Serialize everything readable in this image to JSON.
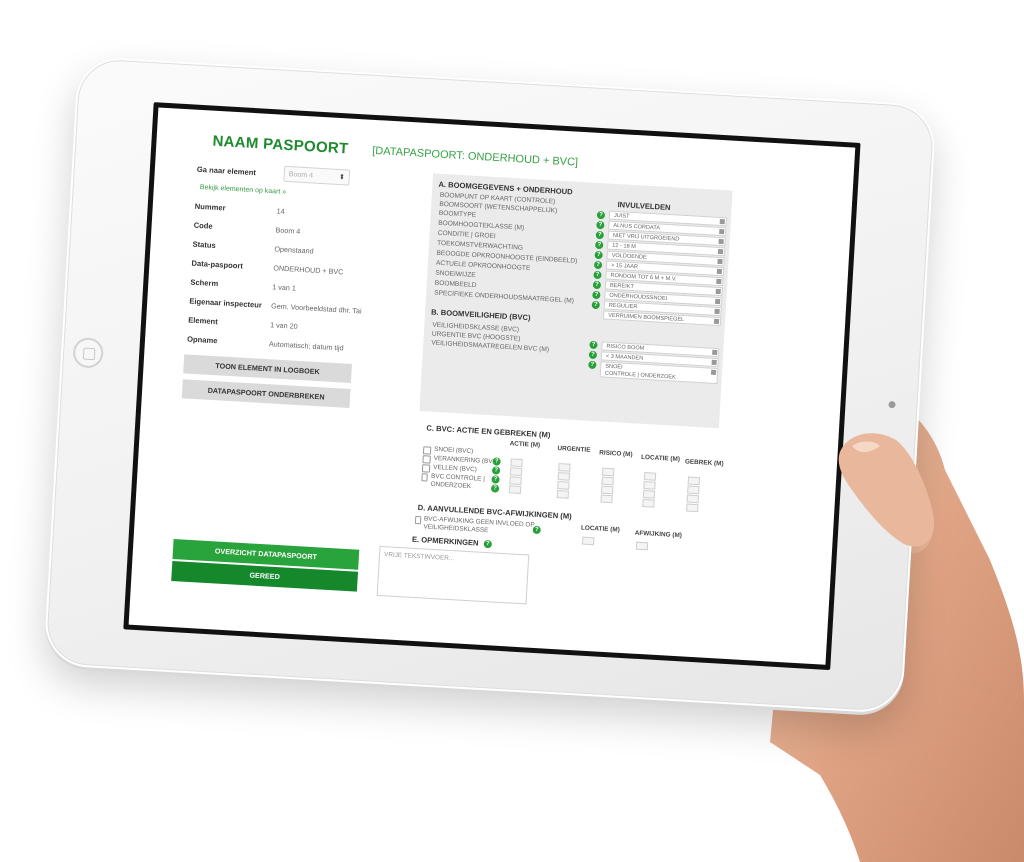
{
  "page": {
    "title": "NAAM PASPOORT",
    "subtitle": "[DATAPASPOORT: ONDERHOUD + BVC]"
  },
  "left": {
    "goto_label": "Ga naar element",
    "goto_value": "Boom 4",
    "map_link": "Bekijk elementen op kaart »",
    "fields": [
      {
        "label": "Nummer",
        "value": "14"
      },
      {
        "label": "Code",
        "value": "Boom 4"
      },
      {
        "label": "Status",
        "value": "Openstaand"
      },
      {
        "label": "Data-paspoort",
        "value": "ONDERHOUD + BVC"
      },
      {
        "label": "Scherm",
        "value": "1 van 1"
      },
      {
        "label": "Eigenaar inspecteur",
        "value": "Gem. Voorbeeldstad dhr. Tai"
      },
      {
        "label": "Element",
        "value": "1 van 20"
      },
      {
        "label": "Opname",
        "value": "Automatisch; datum tijd"
      }
    ],
    "btn_logboek": "TOON ELEMENT IN LOGBOEK",
    "btn_onderbreken": "DATAPASPOORT ONDERBREKEN",
    "btn_overzicht": "OVERZICHT DATAPASPOORT",
    "btn_gereed": "GEREED"
  },
  "section_a": {
    "title": "A. BOOMGEGEVENS + ONDERHOUD",
    "invul_title": "INVULVELDEN",
    "rows": [
      {
        "label": "BOOMPUNT OP KAART (CONTROLE)",
        "value": "JUIST"
      },
      {
        "label": "BOOMSOORT (WETENSCHAPPELIJK)",
        "value": "ALNUS CORDATA"
      },
      {
        "label": "BOOMTYPE",
        "value": "NIET VRIJ UITGROEIEND"
      },
      {
        "label": "BOOMHOOGTEKLASSE (M)",
        "value": "12 - 18 M"
      },
      {
        "label": "CONDITIE | GROEI",
        "value": "VOLDOENDE"
      },
      {
        "label": "TOEKOMSTVERWACHTING",
        "value": "> 15 JAAR"
      },
      {
        "label": "BEOOGDE OPKROONHOOGTE (EINDBEELD)",
        "value": "RONDOM TOT 6 M + M.V."
      },
      {
        "label": "ACTUELE OPKROONHOOGTE",
        "value": "BEREIKT"
      },
      {
        "label": "SNOEIWIJZE",
        "value": "ONDERHOUDSSNOEI"
      },
      {
        "label": "BOOMBEELD",
        "value": "REGULIER"
      },
      {
        "label": "SPECIFIEKE ONDERHOUDSMAATREGEL (M)",
        "value": "VERRUIMEN BOOMSPIEGEL"
      }
    ]
  },
  "section_b": {
    "title": "B. BOOMVEILIGHEID (BVC)",
    "rows": [
      {
        "label": "VEILIGHEIDSKLASSE (BVC)",
        "value": "RISICO BOOM"
      },
      {
        "label": "URGENTIE BVC (HOOGSTE)",
        "value": "< 3 MAANDEN"
      },
      {
        "label": "VEILIGHEIDSMAATREGELEN BVC (M)",
        "value": "SNOEI"
      },
      {
        "label": "",
        "value": "CONTROLE | ONDERZOEK"
      }
    ]
  },
  "section_c": {
    "title": "C. BVC: ACTIE EN GEBREKEN (M)",
    "col_headers": [
      "ACTIE (M)",
      "URGENTIE",
      "RISICO (M)",
      "LOCATIE (M)",
      "GEBREK (M)"
    ],
    "items": [
      "SNOEI (BVC)",
      "VERANKERING (BVC)",
      "VELLEN (BVC)",
      "BVC CONTROLE | ONDERZOEK"
    ]
  },
  "section_d": {
    "title": "D. AANVULLENDE BVC-AFWIJKINGEN (M)",
    "item": "BVC-AFWIJKING GEEN INVLOED OP VEILIGHEIDSKLASSE",
    "col_locatie": "LOCATIE (M)",
    "col_afwijking": "AFWIJKING (M)"
  },
  "section_e": {
    "title": "E. OPMERKINGEN",
    "placeholder": "VRIJE TEKSTINVOER..."
  },
  "colors": {
    "accent_green": "#29a33b",
    "dark_green": "#15882b",
    "title_green": "#1f8a2f",
    "panel_gray": "#ebebeb"
  },
  "icons": [
    "help-icon",
    "select-arrow-icon",
    "checkbox-icon",
    "home-button-icon",
    "camera-icon"
  ]
}
